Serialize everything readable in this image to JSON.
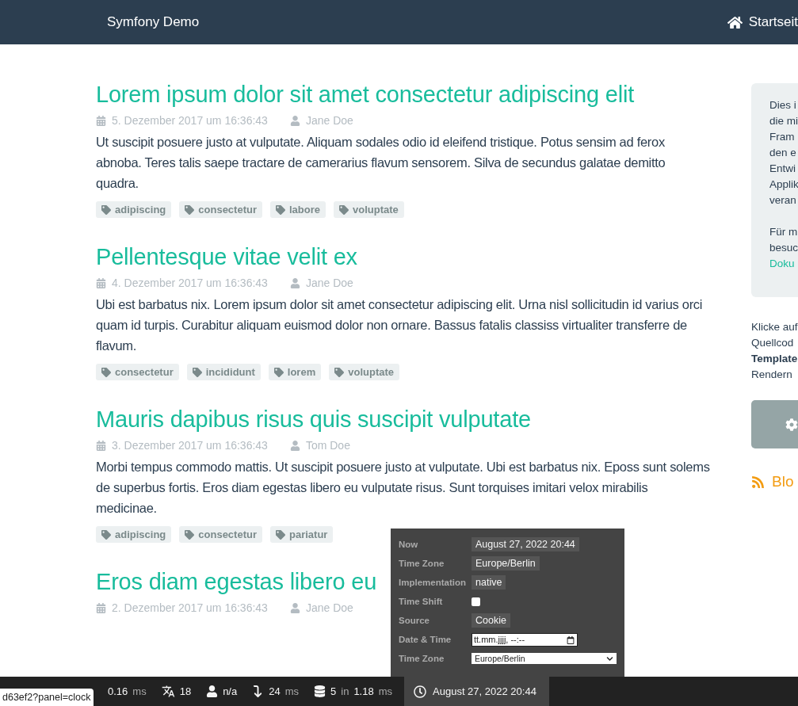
{
  "header": {
    "brand": "Symfony Demo",
    "nav_link": "Startseit"
  },
  "posts": [
    {
      "title": "Lorem ipsum dolor sit amet consectetur adipiscing elit",
      "date": "5. Dezember 2017 um 16:36:43",
      "author": "Jane Doe",
      "text": "Ut suscipit posuere justo at vulputate. Aliquam sodales odio id eleifend tristique. Potus sensim ad ferox abnoba. Teres talis saepe tractare de camerarius flavum sensorem. Silva de secundus galatae demitto quadra.",
      "tags": [
        "adipiscing",
        "consectetur",
        "labore",
        "voluptate"
      ]
    },
    {
      "title": "Pellentesque vitae velit ex",
      "date": "4. Dezember 2017 um 16:36:43",
      "author": "Jane Doe",
      "text": "Ubi est barbatus nix. Lorem ipsum dolor sit amet consectetur adipiscing elit. Urna nisl sollicitudin id varius orci quam id turpis. Curabitur aliquam euismod dolor non ornare. Bassus fatalis classiss virtualiter transferre de flavum.",
      "tags": [
        "consectetur",
        "incididunt",
        "lorem",
        "voluptate"
      ]
    },
    {
      "title": "Mauris dapibus risus quis suscipit vulputate",
      "date": "3. Dezember 2017 um 16:36:43",
      "author": "Tom Doe",
      "text": "Morbi tempus commodo mattis. Ut suscipit posuere justo at vulputate. Ubi est barbatus nix. Eposs sunt solems de superbus fortis. Eros diam egestas libero eu vulputate risus. Sunt torquises imitari velox mirabilis medicinae.",
      "tags": [
        "adipiscing",
        "consectetur",
        "pariatur"
      ]
    },
    {
      "title": "Eros diam egestas libero eu",
      "date": "2. Dezember 2017 um 16:36:43",
      "author": "Jane Doe"
    }
  ],
  "sidebar": {
    "intro_lines": [
      "Dies i",
      "die mi",
      "Fram",
      "den e",
      "Entwi",
      "Applik",
      "veran"
    ],
    "more_lines": [
      "Für m",
      "besuc"
    ],
    "link": "Doku",
    "help_lines": [
      {
        "text": "Klicke auf",
        "bold": false
      },
      {
        "text": "Quellcod",
        "bold": false
      },
      {
        "text": "Template",
        "bold": true
      },
      {
        "text": "Rendern",
        "bold": false
      }
    ],
    "blog_link": "Blo"
  },
  "toolbar": {
    "items": [
      {
        "kind": "time",
        "parts": [
          {
            "text": "0.16",
            "muted": false
          },
          {
            "text": "ms",
            "muted": true
          }
        ]
      },
      {
        "kind": "translation",
        "parts": [
          {
            "text": "18",
            "muted": false
          }
        ]
      },
      {
        "kind": "user",
        "parts": [
          {
            "text": "n/a",
            "muted": false
          }
        ]
      },
      {
        "kind": "twig",
        "parts": [
          {
            "text": "24",
            "muted": false
          },
          {
            "text": "ms",
            "muted": true
          }
        ]
      },
      {
        "kind": "database",
        "parts": [
          {
            "text": "5",
            "muted": false
          },
          {
            "text": "in",
            "muted": true
          },
          {
            "text": "1.18",
            "muted": false
          },
          {
            "text": "ms",
            "muted": true
          }
        ]
      }
    ],
    "clock": {
      "label": "August 27, 2022 20:44",
      "selected": true
    }
  },
  "status_url": "d63ef2?panel=clock",
  "clock_panel": {
    "rows": [
      {
        "label": "Now",
        "kind": "value",
        "value": "August 27, 2022 20:44"
      },
      {
        "label": "Time Zone",
        "kind": "value",
        "value": "Europe/Berlin"
      },
      {
        "label": "Implementation",
        "kind": "value",
        "value": "native"
      },
      {
        "label": "Time Shift",
        "kind": "checkbox",
        "checked": false
      },
      {
        "label": "Source",
        "kind": "value",
        "value": "Cookie"
      },
      {
        "label": "Date & Time",
        "kind": "datetime",
        "placeholder": "tt.mm.jjjj, --:--"
      },
      {
        "label": "Time Zone",
        "kind": "select",
        "value": "Europe/Berlin"
      }
    ]
  }
}
